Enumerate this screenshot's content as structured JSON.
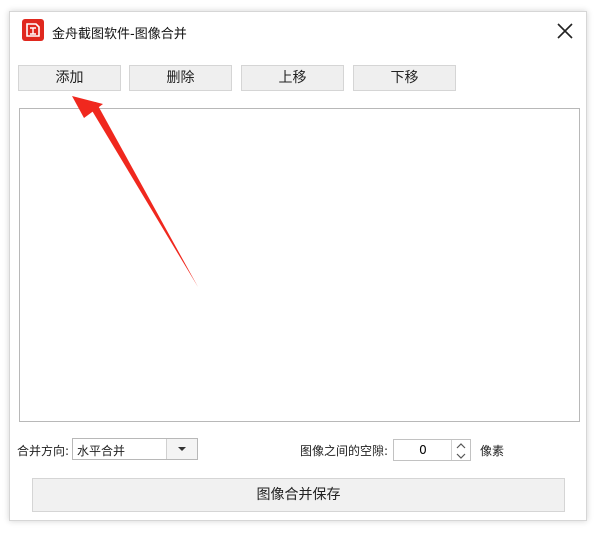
{
  "window": {
    "title": "金舟截图软件-图像合并"
  },
  "toolbar": {
    "add_label": "添加",
    "delete_label": "删除",
    "move_up_label": "上移",
    "move_down_label": "下移"
  },
  "merge": {
    "direction_label": "合并方向:",
    "direction_value": "水平合并",
    "spacing_label": "图像之间的空隙:",
    "spacing_value": "0",
    "spacing_unit": "像素"
  },
  "save_label": "图像合并保存",
  "colors": {
    "accent_icon": "#e0281e",
    "annotation_arrow": "#f0281e"
  },
  "icons": {
    "app": "app-logo-icon",
    "close": "close-icon",
    "dropdown": "chevron-down-icon",
    "spin_up": "chevron-up-icon",
    "spin_down": "chevron-down-icon",
    "annotation": "arrow-annotation-icon"
  }
}
